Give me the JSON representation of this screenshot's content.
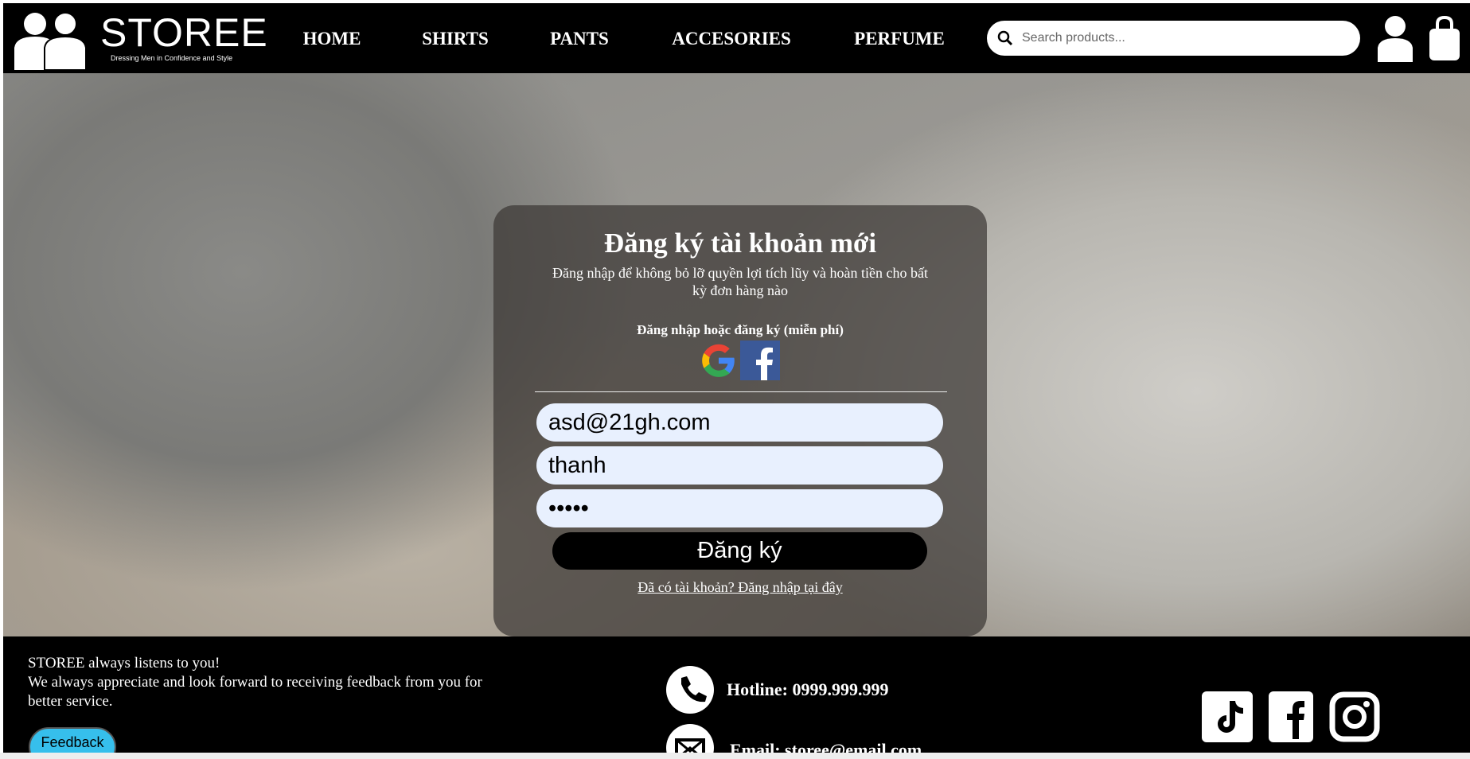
{
  "header": {
    "brand": "STOREE",
    "tagline": "Dressing Men in Confidence and Style",
    "nav": [
      "HOME",
      "SHIRTS",
      "PANTS",
      "ACCESORIES",
      "PERFUME"
    ],
    "search_placeholder": "Search products..."
  },
  "form": {
    "title": "Đăng ký tài khoản mới",
    "subtitle": "Đăng nhập để không bỏ lỡ quyền lợi tích lũy và hoàn tiền cho bất kỳ đơn hàng nào",
    "social_label": "Đăng nhập hoặc đăng ký (miễn phí)",
    "email": "asd@21gh.com",
    "name": "thanh",
    "password": "12345",
    "submit": "Đăng ký",
    "login_link": "Đã có tài khoản? Đăng nhập tại đây"
  },
  "footer": {
    "line1": "STOREE always listens to you!",
    "line2": "We always appreciate and look forward to receiving feedback from you for better service.",
    "feedback": "Feedback",
    "hotline": "Hotline: 0999.999.999",
    "email": "Email: storee@email.com"
  }
}
